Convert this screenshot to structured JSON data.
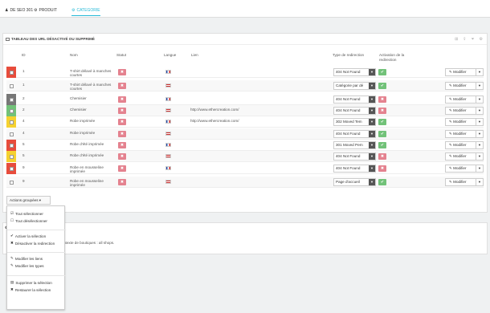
{
  "topbar": {
    "tabs": [
      {
        "label": "DE SEO 301",
        "icon": "user-icon"
      },
      {
        "label": "PRODUIT",
        "icon": "gear-icon"
      },
      {
        "label": "CATEGORIE",
        "icon": "gear-icon",
        "active": true
      }
    ]
  },
  "panel": {
    "title": "TABLEAU DES URL DÉSACTIVÉ OU SUPPRIMÉ",
    "header_icons": [
      "add-icon",
      "export-icon",
      "filter-icon",
      "settings-icon"
    ]
  },
  "table": {
    "headers": {
      "id": "ID",
      "nom": "Nom",
      "statut": "Statut",
      "langue": "Langue",
      "lien": "Lien",
      "type": "Type de redirection",
      "activation": "Activation de la redirection"
    },
    "rows": [
      {
        "color": "#e74c3c",
        "checked": true,
        "id": "1",
        "nom": "T-shirt délavé à manches courtes",
        "flag": "fr",
        "lien": "",
        "type": "404 Not Found",
        "active": true,
        "modify": "Modifier"
      },
      {
        "color": "",
        "checked": false,
        "id": "1",
        "nom": "T-shirt délavé à manches courtes",
        "flag": "us",
        "lien": "",
        "type": "Catégorie par dé",
        "active": true,
        "modify": "Modifier"
      },
      {
        "color": "#777777",
        "checked": true,
        "id": "2",
        "nom": "Chemisier",
        "flag": "fr",
        "lien": "",
        "type": "404 Not Found",
        "active": false,
        "modify": "Modifier"
      },
      {
        "color": "#72c279",
        "checked": false,
        "id": "2",
        "nom": "Chemisier",
        "flag": "us",
        "lien": "http://www.ethercreation.com/",
        "type": "404 Not Found",
        "active": false,
        "modify": "Modifier"
      },
      {
        "color": "#f5d130",
        "checked": false,
        "id": "4",
        "nom": "Robe imprimée",
        "flag": "fr",
        "lien": "http://www.ethercreation.com/",
        "type": "302 Moved Tem",
        "active": true,
        "modify": "Modifier"
      },
      {
        "color": "",
        "checked": false,
        "id": "4",
        "nom": "Robe imprimée",
        "flag": "us",
        "lien": "",
        "type": "404 Not Found",
        "active": true,
        "modify": "Modifier"
      },
      {
        "color": "#e74c3c",
        "checked": true,
        "id": "5",
        "nom": "Robe d'été imprimée",
        "flag": "fr",
        "lien": "",
        "type": "301 Moved Pern",
        "active": true,
        "modify": "Modifier"
      },
      {
        "color": "#f5d130",
        "checked": false,
        "id": "5",
        "nom": "Robe d'été imprimée",
        "flag": "us",
        "lien": "",
        "type": "404 Not Found",
        "active": false,
        "modify": "Modifier"
      },
      {
        "color": "#e74c3c",
        "checked": true,
        "id": "9",
        "nom": "Robe en mousseline imprimée",
        "flag": "fr",
        "lien": "",
        "type": "404 Not Found",
        "active": false,
        "modify": "Modifier"
      },
      {
        "color": "",
        "checked": false,
        "id": "9",
        "nom": "Robe en mousseline imprimée",
        "flag": "us",
        "lien": "",
        "type": "Page d'accueil",
        "active": true,
        "modify": "Modifier"
      }
    ]
  },
  "bulk": {
    "label": "Actions groupées ▾",
    "items": [
      "Tout sélectionner",
      "Tout désélectionner",
      "Activer la sélection",
      "Désactiver la redirection",
      "Modifier les liens",
      "Modifier les types",
      "Supprimer la sélection",
      "Restaurer la sélection"
    ]
  },
  "panel2": {
    "text": "ntexte de boutiques : all shops."
  }
}
